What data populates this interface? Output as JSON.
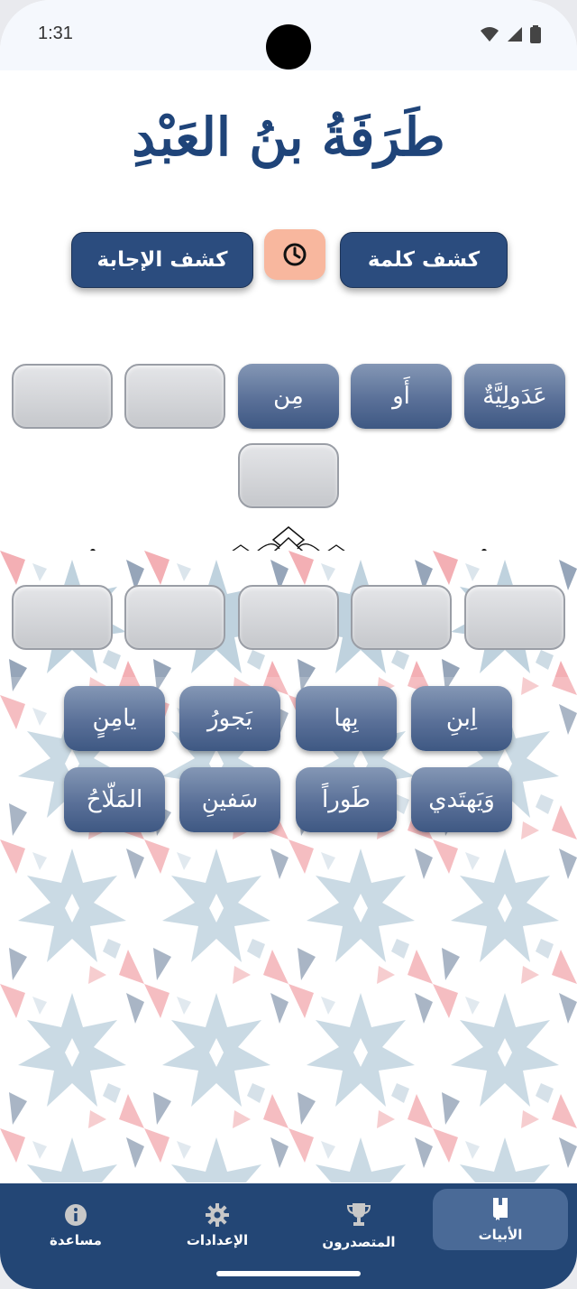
{
  "status_bar": {
    "time": "1:31"
  },
  "title": "طَرَفَةُ بنُ العَبْدِ",
  "actions": {
    "reveal_word": "كشف كلمة",
    "reveal_answer": "كشف الإجابة",
    "timer_icon": "clock-icon"
  },
  "verse_line_1": [
    "عَدَولِيَّةٌ",
    "أَو",
    "مِن",
    "",
    "",
    ""
  ],
  "verse_line_2": [
    "",
    "",
    "",
    "",
    ""
  ],
  "choices": [
    "اِبنِ",
    "بِها",
    "يَجورُ",
    "يامِنٍ",
    "وَيَهتَدي",
    "طَوراً",
    "سَفينِ",
    "المَلّاحُ"
  ],
  "nav": {
    "verses": "الأبيات",
    "leaders": "المتصدرون",
    "settings": "الإعدادات",
    "help": "مساعدة"
  },
  "colors": {
    "primary": "#2b4c7e",
    "title": "#1f4479",
    "timer": "#f8b79e",
    "navbar": "#234675"
  }
}
